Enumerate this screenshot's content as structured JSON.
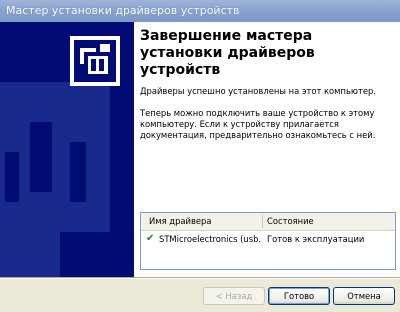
{
  "window": {
    "title": "Мастер установки драйверов устройств"
  },
  "content": {
    "heading": "Завершение мастера установки драйверов устройств",
    "paragraph1": "Драйверы успешно установлены на этот компьютер.",
    "paragraph2": "Теперь можно подключить ваше устройство к этому компьютеру. Если к устройству прилагается документация, предварительно ознакомьтесь с ней."
  },
  "driver_table": {
    "headers": [
      "Имя драйвера",
      "Состояние"
    ],
    "rows": [
      {
        "name": "STMicroelectronics (usb...",
        "status": "Готов к эксплуатации"
      }
    ]
  },
  "buttons": {
    "back": "< Назад",
    "finish": "Готово",
    "cancel": "Отмена"
  },
  "colors": {
    "banner": "#000c73",
    "titlebar": "#8aa3cf"
  }
}
